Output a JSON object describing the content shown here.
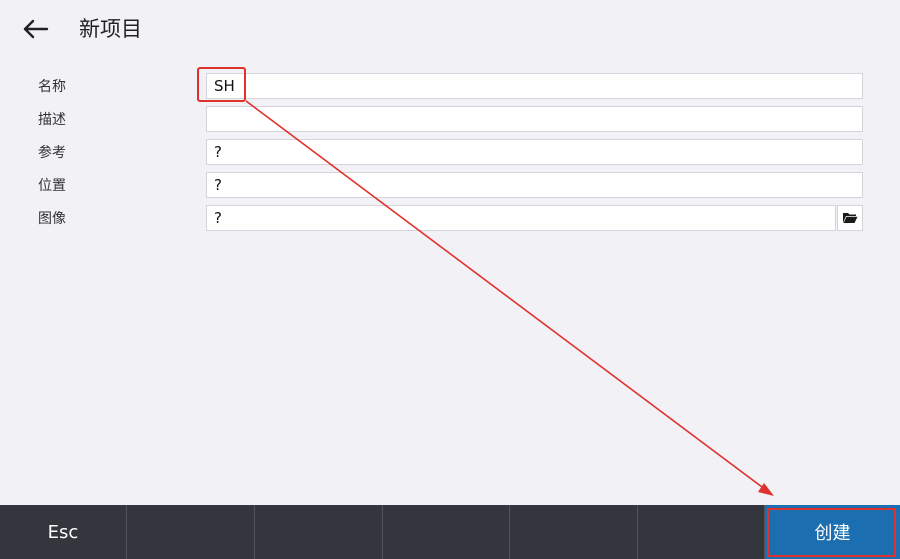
{
  "header": {
    "title": "新项目"
  },
  "form": {
    "fields": [
      {
        "label": "名称",
        "value": "SH"
      },
      {
        "label": "描述",
        "value": ""
      },
      {
        "label": "参考",
        "value": "?"
      },
      {
        "label": "位置",
        "value": "?"
      },
      {
        "label": "图像",
        "value": "?"
      }
    ]
  },
  "softkeys": {
    "esc": "Esc",
    "key2": "",
    "key3": "",
    "key4": "",
    "key5": "",
    "create": "创建"
  },
  "colors": {
    "background": "#f2f1f6",
    "bottom_bar": "#34363d",
    "primary_button": "#1b6fb0",
    "annotation_red": "#e0322c"
  },
  "icons": {
    "back": "arrow-left-icon",
    "browse": "folder-open-icon"
  }
}
